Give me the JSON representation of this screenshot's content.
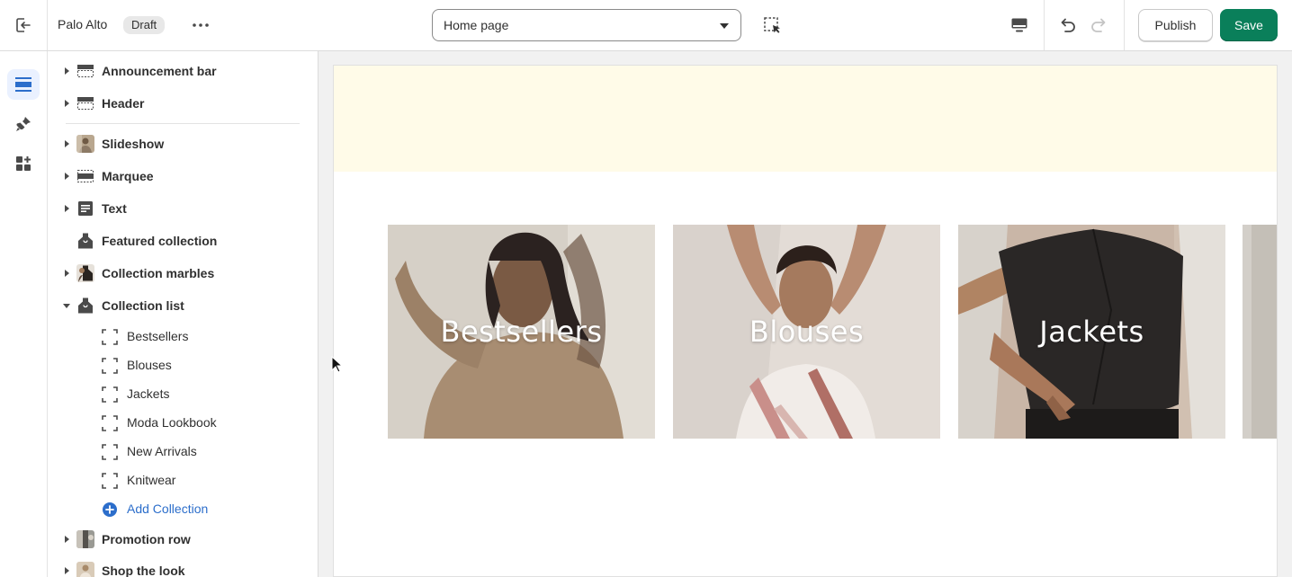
{
  "topbar": {
    "store_name": "Palo Alto",
    "status_badge": "Draft",
    "page_select": {
      "value": "Home page"
    },
    "publish_label": "Publish",
    "save_label": "Save"
  },
  "colors": {
    "save_green": "#0a7f5a",
    "link_blue": "#2c6ecb",
    "announcement_bg": "#fffbe8",
    "active_rail": "#eaf1ff"
  },
  "rail": {
    "items": [
      {
        "icon": "sections-icon",
        "active": true
      },
      {
        "icon": "theme-settings-icon",
        "active": false
      },
      {
        "icon": "app-embeds-icon",
        "active": false
      }
    ]
  },
  "sidebar": {
    "header_sections": [
      {
        "label": "Announcement bar",
        "icon": "section-layout-icon"
      },
      {
        "label": "Header",
        "icon": "section-layout-icon"
      }
    ],
    "sections": [
      {
        "label": "Slideshow",
        "icon": "image-thumbnail"
      },
      {
        "label": "Marquee",
        "icon": "section-layout-icon"
      },
      {
        "label": "Text",
        "icon": "text-block-icon"
      },
      {
        "label": "Featured collection",
        "icon": "collection-tag-icon"
      },
      {
        "label": "Collection marbles",
        "icon": "image-thumbnail"
      },
      {
        "label": "Collection list",
        "icon": "collection-tag-icon"
      }
    ],
    "collection_list_blocks": [
      {
        "label": "Bestsellers",
        "icon": "block-dashed-icon"
      },
      {
        "label": "Blouses",
        "icon": "block-dashed-icon"
      },
      {
        "label": "Jackets",
        "icon": "block-dashed-icon"
      },
      {
        "label": "Moda Lookbook",
        "icon": "block-dashed-icon"
      },
      {
        "label": "New Arrivals",
        "icon": "block-dashed-icon"
      },
      {
        "label": "Knitwear",
        "icon": "block-dashed-icon"
      }
    ],
    "add_collection_label": "Add Collection",
    "more_sections": [
      {
        "label": "Promotion row",
        "icon": "image-thumbnail"
      },
      {
        "label": "Shop the look",
        "icon": "image-thumbnail"
      }
    ]
  },
  "preview": {
    "collections": [
      {
        "title": "Bestsellers"
      },
      {
        "title": "Blouses"
      },
      {
        "title": "Jackets"
      }
    ]
  }
}
